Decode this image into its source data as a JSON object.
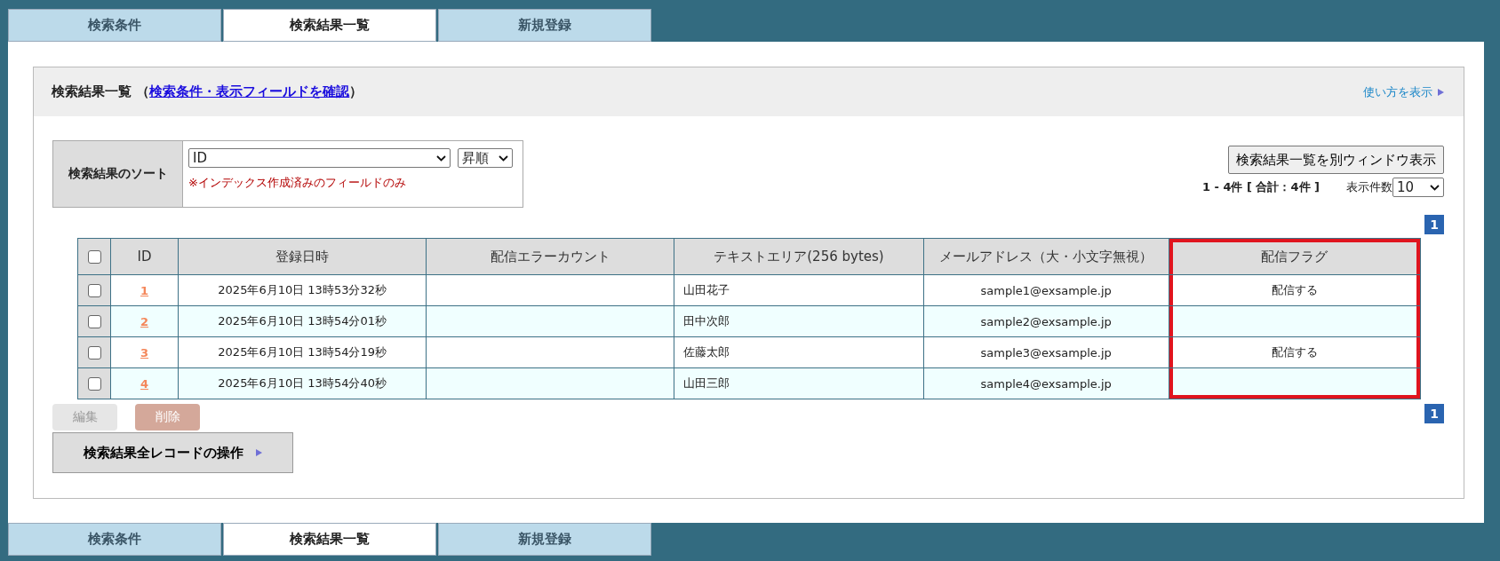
{
  "tabs_top": [
    {
      "label": "検索条件",
      "selected": false
    },
    {
      "label": "検索結果一覧",
      "selected": true
    },
    {
      "label": "新規登録",
      "selected": false
    }
  ],
  "panel": {
    "title": "検索結果一覧",
    "open_paren": "（",
    "link": "検索条件・表示フィールドを確認",
    "close_paren": "）",
    "help_link": "使い方を表示"
  },
  "sort": {
    "label": "検索結果のソート",
    "field": "ID",
    "order": "昇順",
    "note": "※インデックス作成済みのフィールドのみ"
  },
  "results": {
    "popup_button": "検索結果一覧を別ウィンドウ表示",
    "count": "1 - 4件 [ 合計：4件 ]",
    "per_page_label": "表示件数",
    "per_page": "10"
  },
  "pages_top": [
    {
      "label": "1",
      "selected": true
    }
  ],
  "table": {
    "select_all": {
      "checked": false
    },
    "columns": [
      {
        "label": "ID",
        "kind": "link",
        "highlighted": false
      },
      {
        "label": "登録日時",
        "kind": "center",
        "highlighted": false
      },
      {
        "label": "配信エラーカウント",
        "kind": "center",
        "highlighted": false
      },
      {
        "label": "テキストエリア(256 bytes)",
        "kind": "left",
        "highlighted": false
      },
      {
        "label": "メールアドレス（大・小文字無視）",
        "kind": "center",
        "highlighted": false
      },
      {
        "label": "配信フラグ",
        "kind": "center",
        "highlighted": true
      }
    ],
    "rows": [
      {
        "checked": false,
        "id": "1",
        "created": "2025年6月10日 13時53分32秒",
        "text_area": "山田花子",
        "email": "sample1@exsample.jp",
        "flag": "配信する"
      },
      {
        "checked": false,
        "id": "2",
        "created": "2025年6月10日 13時54分01秒",
        "text_area": "田中次郎",
        "email": "sample2@exsample.jp"
      },
      {
        "checked": false,
        "id": "3",
        "created": "2025年6月10日 13時54分19秒",
        "text_area": "佐藤太郎",
        "email": "sample3@exsample.jp",
        "flag": "配信する"
      },
      {
        "checked": false,
        "id": "4",
        "created": "2025年6月10日 13時54分40秒",
        "text_area": "山田三郎",
        "email": "sample4@exsample.jp"
      }
    ]
  },
  "pages_bottom": [
    {
      "label": "1",
      "selected": true
    }
  ],
  "buttons": [
    {
      "kind": "edit",
      "label": "編集",
      "disabled": true
    },
    {
      "kind": "delete",
      "label": "削除",
      "disabled": true
    }
  ],
  "bulk_button": "検索結果全レコードの操作",
  "tabs_bottom": [
    {
      "label": "検索条件",
      "selected": false
    },
    {
      "label": "検索結果一覧",
      "selected": true
    },
    {
      "label": "新規登録",
      "selected": false
    }
  ]
}
